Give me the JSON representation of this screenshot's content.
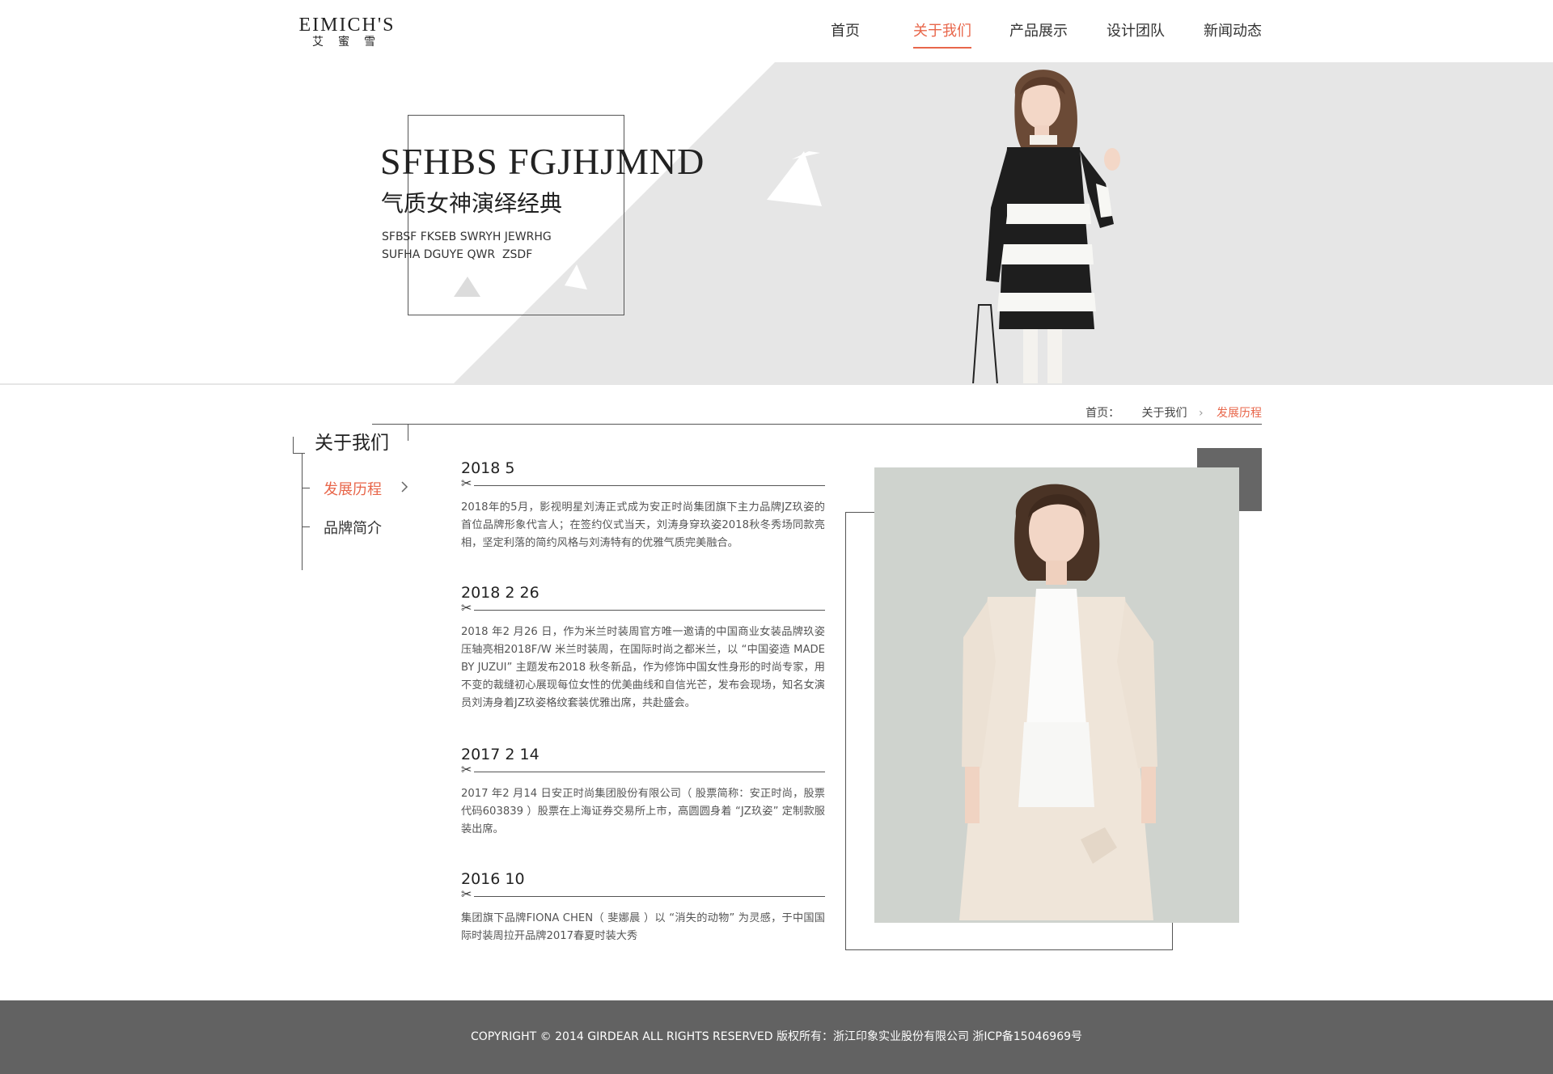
{
  "header": {
    "logo_main": "EIMICH'S",
    "logo_sub": "艾蜜雪",
    "nav": [
      {
        "label": "首页"
      },
      {
        "label": "关于我们",
        "active": true
      },
      {
        "label": "产品展示"
      },
      {
        "label": "设计团队"
      },
      {
        "label": "新闻动态"
      }
    ]
  },
  "banner": {
    "title": "SFHBS FGJHJMND",
    "subtitle": "气质女神演绎经典",
    "line1": "SFBSF FKSEB SWRYH JEWRHG",
    "line2": "SUFHA DGUYE QWR  ZSDF"
  },
  "breadcrumb": {
    "home": "首页：",
    "section": "关于我们",
    "current": "发展历程"
  },
  "sidebar": {
    "title": "关于我们",
    "items": [
      {
        "label": "发展历程",
        "active": true
      },
      {
        "label": "品牌简介"
      }
    ]
  },
  "timeline": [
    {
      "date": "2018 5",
      "text": "2018年的5月，影视明星刘涛正式成为安正时尚集团旗下主力品牌JZ玖姿的首位品牌形象代言人；在签约仪式当天，刘涛身穿玖姿2018秋冬秀场同款亮相，坚定利落的简约风格与刘涛特有的优雅气质完美融合。"
    },
    {
      "date": "2018 2 26",
      "text": "2018 年2 月26 日，作为米兰时装周官方唯一邀请的中国商业女装品牌玖姿压轴亮相2018F/W 米兰时装周，在国际时尚之都米兰，以 “中国姿造 MADE BY JUZUI” 主题发布2018 秋冬新品，作为修饰中国女性身形的时尚专家，用不变的裁缝初心展现每位女性的优美曲线和自信光芒，发布会现场，知名女演员刘涛身着JZ玖姿格纹套装优雅出席，共赴盛会。"
    },
    {
      "date": "2017 2 14",
      "text": "2017 年2 月14 日安正时尚集团股份有限公司（ 股票简称：安正时尚，股票代码603839 ）股票在上海证券交易所上市，高圆圆身着 “JZ玖姿” 定制款服装出席。"
    },
    {
      "date": "2016 10",
      "text": "集团旗下品牌FIONA CHEN（ 斐娜晨 ）以 “消失的动物” 为灵感，于中国国际时装周拉开品牌2017春夏时装大秀"
    }
  ],
  "footer": {
    "copyright": "COPYRIGHT © 2014 GIRDEAR ALL RIGHTS RESERVED 版权所有：浙江印象实业股份有限公司  浙ICP备15046969号"
  },
  "colors": {
    "accent": "#e8664a",
    "banner_gray": "#e6e6e6",
    "footer_bg": "#626262"
  }
}
